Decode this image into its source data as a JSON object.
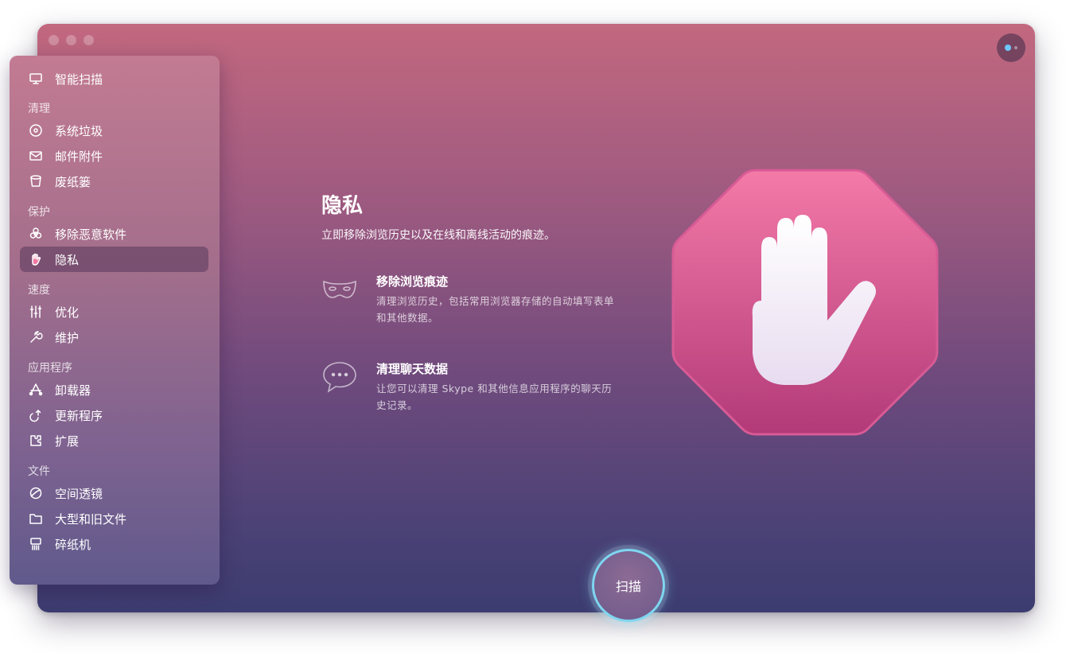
{
  "window": {
    "controls": [
      "close",
      "minimize",
      "zoom"
    ]
  },
  "sidebar": {
    "top_item": {
      "label": "智能扫描",
      "icon": "monitor-icon"
    },
    "sections": [
      {
        "header": "清理",
        "items": [
          {
            "label": "系统垃圾",
            "icon": "disk-icon"
          },
          {
            "label": "邮件附件",
            "icon": "mail-icon"
          },
          {
            "label": "废纸篓",
            "icon": "trash-icon"
          }
        ]
      },
      {
        "header": "保护",
        "items": [
          {
            "label": "移除恶意软件",
            "icon": "biohazard-icon"
          },
          {
            "label": "隐私",
            "icon": "hand-icon",
            "active": true
          }
        ]
      },
      {
        "header": "速度",
        "items": [
          {
            "label": "优化",
            "icon": "sliders-icon"
          },
          {
            "label": "维护",
            "icon": "wrench-icon"
          }
        ]
      },
      {
        "header": "应用程序",
        "items": [
          {
            "label": "卸载器",
            "icon": "uninstaller-icon"
          },
          {
            "label": "更新程序",
            "icon": "update-icon"
          },
          {
            "label": "扩展",
            "icon": "puzzle-icon"
          }
        ]
      },
      {
        "header": "文件",
        "items": [
          {
            "label": "空间透镜",
            "icon": "planet-icon"
          },
          {
            "label": "大型和旧文件",
            "icon": "folder-icon"
          },
          {
            "label": "碎纸机",
            "icon": "shredder-icon"
          }
        ]
      }
    ]
  },
  "main": {
    "title": "隐私",
    "subtitle": "立即移除浏览历史以及在线和离线活动的痕迹。",
    "features": [
      {
        "title": "移除浏览痕迹",
        "desc_line1": "清理浏览历史，包括常用浏览器存储的自动填写表单",
        "desc_line2": "和其他数据。",
        "icon": "mask-icon"
      },
      {
        "title": "清理聊天数据",
        "desc_line1": "让您可以清理 Skype 和其他信息应用程序的聊天历",
        "desc_line2": "史记录。",
        "icon": "chat-bubble-icon"
      }
    ],
    "hero_icon": "stop-hand-icon"
  },
  "scan_button": {
    "label": "扫描"
  },
  "colors": {
    "accent_ring": "#7fd6f0",
    "hero_top": "#f47aa8",
    "hero_bottom": "#b23a78"
  }
}
